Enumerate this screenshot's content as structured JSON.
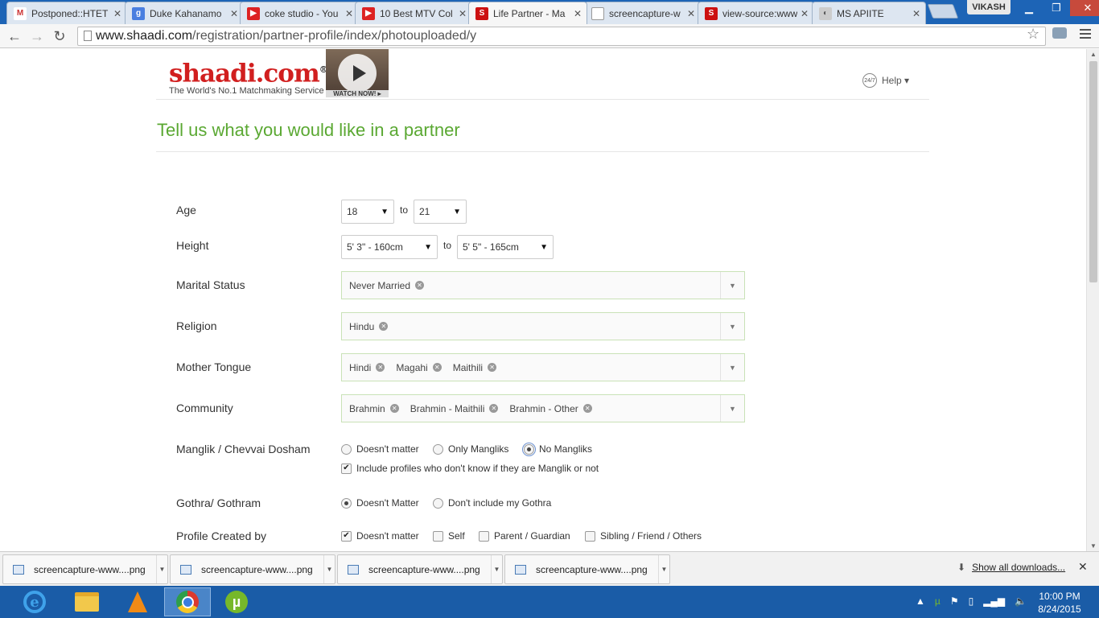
{
  "browser": {
    "tabs": [
      {
        "title": "Postponed::HTET",
        "favicon": "gmail-icon",
        "color": "#c33"
      },
      {
        "title": "Duke Kahanamo",
        "favicon": "google-icon",
        "color": "#4a7fe0"
      },
      {
        "title": "coke studio - You",
        "favicon": "youtube-icon",
        "color": "#d22"
      },
      {
        "title": "10 Best MTV Col",
        "favicon": "youtube-icon",
        "color": "#d22"
      },
      {
        "title": "Life Partner - Ma",
        "favicon": "shaadi-icon",
        "color": "#c11"
      },
      {
        "title": "screencapture-w",
        "favicon": "page-icon",
        "color": "#999"
      },
      {
        "title": "view-source:www",
        "favicon": "shaadi-icon",
        "color": "#c11"
      },
      {
        "title": "MS APIITE",
        "favicon": "site-icon",
        "color": "#777"
      }
    ],
    "user": "VIKASH",
    "url_host": "www.shaadi.com",
    "url_path": "/registration/partner-profile/index/photouploaded/y"
  },
  "header": {
    "brand": "shaadi.com",
    "registered": "®",
    "tagline": "The World's No.1 Matchmaking Service",
    "promo_label": "WATCH NOW! ▸",
    "help_clock": "24/7",
    "help_label": "Help ▾"
  },
  "form": {
    "title": "Tell us what you would like in a partner",
    "age": {
      "label": "Age",
      "from": "18",
      "to_word": "to",
      "to": "21"
    },
    "height": {
      "label": "Height",
      "from": "5' 3\" - 160cm",
      "to_word": "to",
      "to": "5' 5\" - 165cm"
    },
    "marital_status": {
      "label": "Marital Status",
      "chips": [
        "Never Married"
      ]
    },
    "religion": {
      "label": "Religion",
      "chips": [
        "Hindu"
      ]
    },
    "mother_tongue": {
      "label": "Mother Tongue",
      "chips": [
        "Hindi",
        "Magahi",
        "Maithili"
      ]
    },
    "community": {
      "label": "Community",
      "chips": [
        "Brahmin",
        "Brahmin - Maithili",
        "Brahmin - Other"
      ]
    },
    "manglik": {
      "label": "Manglik / Chevvai Dosham",
      "options": [
        "Doesn't matter",
        "Only Mangliks",
        "No Mangliks"
      ],
      "selected": "No Mangliks",
      "include_unknown": "Include profiles who don't know if they are Manglik or not",
      "include_unknown_checked": true
    },
    "gothra": {
      "label": "Gothra/ Gothram",
      "options": [
        "Doesn't Matter",
        "Don't include my Gothra"
      ],
      "selected": "Doesn't Matter"
    },
    "profile_created_by": {
      "label": "Profile Created by",
      "options": [
        {
          "label": "Doesn't matter",
          "checked": true
        },
        {
          "label": "Self",
          "checked": false
        },
        {
          "label": "Parent / Guardian",
          "checked": false
        },
        {
          "label": "Sibling / Friend / Others",
          "checked": false
        }
      ]
    }
  },
  "downloads": {
    "items": [
      "screencapture-www....png",
      "screencapture-www....png",
      "screencapture-www....png",
      "screencapture-www....png"
    ],
    "show_all": "Show all downloads..."
  },
  "taskbar": {
    "time": "10:00 PM",
    "date": "8/24/2015"
  },
  "colors": {
    "accent_green": "#5aa832",
    "brand_red": "#d11f1f",
    "taskbar_blue": "#1a5ca7"
  }
}
